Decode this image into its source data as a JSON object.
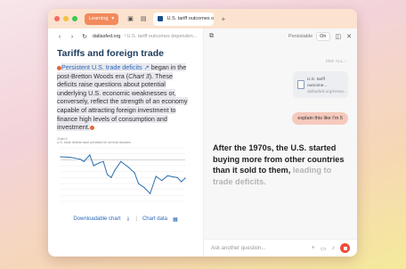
{
  "colors": {
    "accent": "#f28a5c",
    "link": "#2a69b8",
    "heading": "#1d3a5c",
    "stop": "#f04b3c",
    "bubble": "#f6c9bd"
  },
  "tabs": {
    "learning_label": "Learning",
    "active_tab_label": "U.S. tariff outcomes o"
  },
  "address": {
    "domain": "dallasfed.org",
    "path": "/ U.S. tariff outcomes dependen..."
  },
  "article": {
    "title": "Tariffs and foreign trade",
    "link_text": "Persistent U.S. trade deficits",
    "body_1": " began in the post-Bretton Woods era (",
    "chart_ref": "Chart 3",
    "body_2": "). These deficits raise questions about potential underlying U.S. economic weaknesses or, conversely, reflect the strength of an economy capable of attracting foreign investment to finance high levels of consumption and investment.",
    "chart_label": "Chart 3",
    "chart_caption": "U.S. trade deficits have persisted for several decades",
    "downloadable": "Downloadable chart",
    "chart_data_link": "Chart data"
  },
  "assistant": {
    "persistable_label": "Persistable",
    "toggle": "On",
    "see_all": "SEE ALL",
    "shared_card_title": "U.S. tariff outcome...",
    "shared_card_domain": "dallasfed.org/resea...",
    "user_message": "explain this like I'm 5",
    "answer_main": "After the 1970s, the U.S. started buying more from other countries than it sold to them, ",
    "answer_fade": "leading to trade deficits.",
    "ask_placeholder": "Ask another question..."
  },
  "chart_data": {
    "type": "line",
    "x": [
      1960,
      1965,
      1970,
      1972,
      1975,
      1977,
      1980,
      1982,
      1984,
      1986,
      1988,
      1991,
      1995,
      1998,
      2000,
      2003,
      2006,
      2009,
      2012,
      2015,
      2018,
      2020,
      2022,
      2024
    ],
    "series": [
      {
        "values": [
          0.5,
          0.4,
          0.1,
          -0.3,
          0.8,
          -1.0,
          -0.5,
          -0.3,
          -2.5,
          -3.0,
          -1.7,
          -0.3,
          -1.3,
          -2.2,
          -4.0,
          -4.7,
          -5.7,
          -2.8,
          -3.5,
          -2.7,
          -2.9,
          -3.0,
          -3.7,
          -3.1
        ]
      }
    ],
    "ylim": [
      -7,
      2
    ]
  }
}
